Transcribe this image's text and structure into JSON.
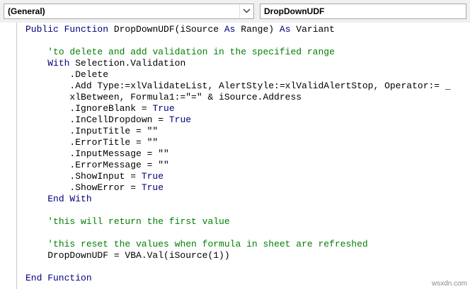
{
  "header": {
    "object_combo": "(General)",
    "procedure_combo": "DropDownUDF"
  },
  "code_lines": [
    [
      {
        "t": "Public Function",
        "k": "kw"
      },
      {
        "t": " DropDownUDF(iSource "
      },
      {
        "t": "As",
        "k": "kw"
      },
      {
        "t": " Range) "
      },
      {
        "t": "As",
        "k": "kw"
      },
      {
        "t": " Variant"
      }
    ],
    [],
    [
      {
        "t": "    "
      },
      {
        "t": "'to delete and add validation in the specified range",
        "k": "cm"
      }
    ],
    [
      {
        "t": "    "
      },
      {
        "t": "With",
        "k": "kw"
      },
      {
        "t": " Selection.Validation"
      }
    ],
    [
      {
        "t": "        .Delete"
      }
    ],
    [
      {
        "t": "        .Add Type:=xlValidateList, AlertStyle:=xlValidAlertStop, Operator:= _"
      }
    ],
    [
      {
        "t": "        xlBetween, Formula1:=\"=\" & iSource.Address"
      }
    ],
    [
      {
        "t": "        .IgnoreBlank = "
      },
      {
        "t": "True",
        "k": "kw"
      }
    ],
    [
      {
        "t": "        .InCellDropdown = "
      },
      {
        "t": "True",
        "k": "kw"
      }
    ],
    [
      {
        "t": "        .InputTitle = \"\""
      }
    ],
    [
      {
        "t": "        .ErrorTitle = \"\""
      }
    ],
    [
      {
        "t": "        .InputMessage = \"\""
      }
    ],
    [
      {
        "t": "        .ErrorMessage = \"\""
      }
    ],
    [
      {
        "t": "        .ShowInput = "
      },
      {
        "t": "True",
        "k": "kw"
      }
    ],
    [
      {
        "t": "        .ShowError = "
      },
      {
        "t": "True",
        "k": "kw"
      }
    ],
    [
      {
        "t": "    "
      },
      {
        "t": "End With",
        "k": "kw"
      }
    ],
    [],
    [
      {
        "t": "    "
      },
      {
        "t": "'this will return the first value",
        "k": "cm"
      }
    ],
    [],
    [
      {
        "t": "    "
      },
      {
        "t": "'this reset the values when formula in sheet are refreshed",
        "k": "cm"
      }
    ],
    [
      {
        "t": "    DropDownUDF = VBA.Val(iSource(1))"
      }
    ],
    [],
    [
      {
        "t": "End Function",
        "k": "kw"
      }
    ]
  ],
  "watermark": "wsxdn.com",
  "colors": {
    "keyword": "#00007f",
    "comment": "#007f00",
    "text": "#000000"
  },
  "icons": {
    "combo_arrow": "chevron-down-icon"
  }
}
